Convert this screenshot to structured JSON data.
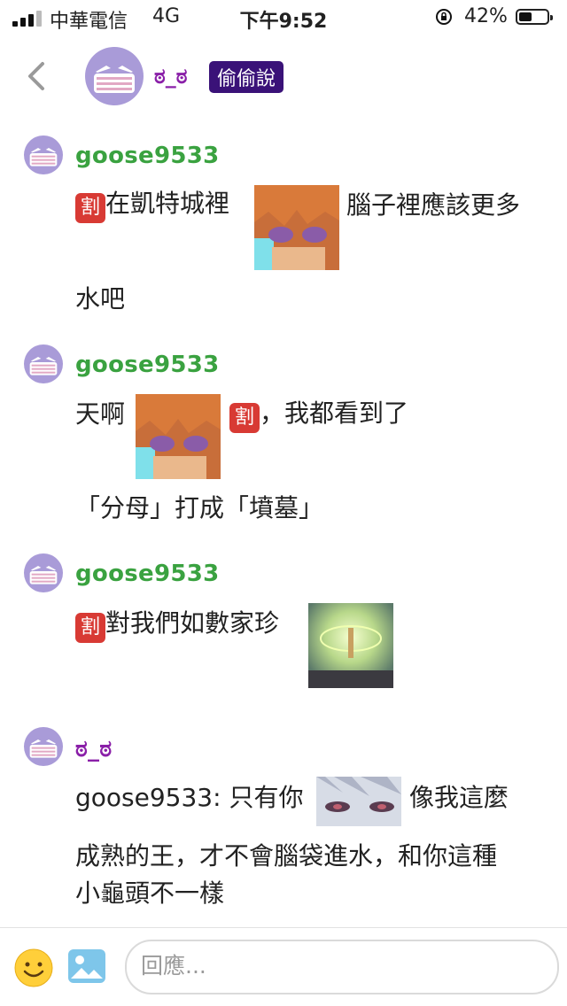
{
  "status_bar": {
    "carrier": "中華電信",
    "network": "4G",
    "time": "下午9:52",
    "battery": "42%",
    "battery_level": 0.42
  },
  "header": {
    "name": "ಠ_ಠ",
    "badge": "偷偷說",
    "back_icon": "chevron-left-icon"
  },
  "messages": [
    {
      "author": "goose9533",
      "lines": [
        "在凱特城裡",
        "腦子裡應該更多",
        "水吧"
      ],
      "sticker": "anime-orange-hair-face"
    },
    {
      "author": "goose9533",
      "lines": [
        "天啊",
        "，我都看到了",
        "「分母」打成「墳墓」"
      ],
      "sticker": "anime-orange-hair-face"
    },
    {
      "author": "goose9533",
      "lines": [
        "對我們如數家珍"
      ],
      "sticker": "anime-glowing-figure"
    },
    {
      "author": "ಠ_ಠ",
      "lines": [
        "goose9533: 只有你",
        "像我這麼",
        "成熟的王，才不會腦袋進水，和你這種",
        "小龜頭不一樣"
      ],
      "sticker": "anime-silver-hair-eyes"
    }
  ],
  "badge_cut": "割",
  "input": {
    "placeholder": "回應..."
  },
  "colors": {
    "author_green": "#3aa240",
    "author_purple": "#8a1fa8",
    "badge_bg": "#3a1278",
    "cut_badge": "#d83a34"
  }
}
